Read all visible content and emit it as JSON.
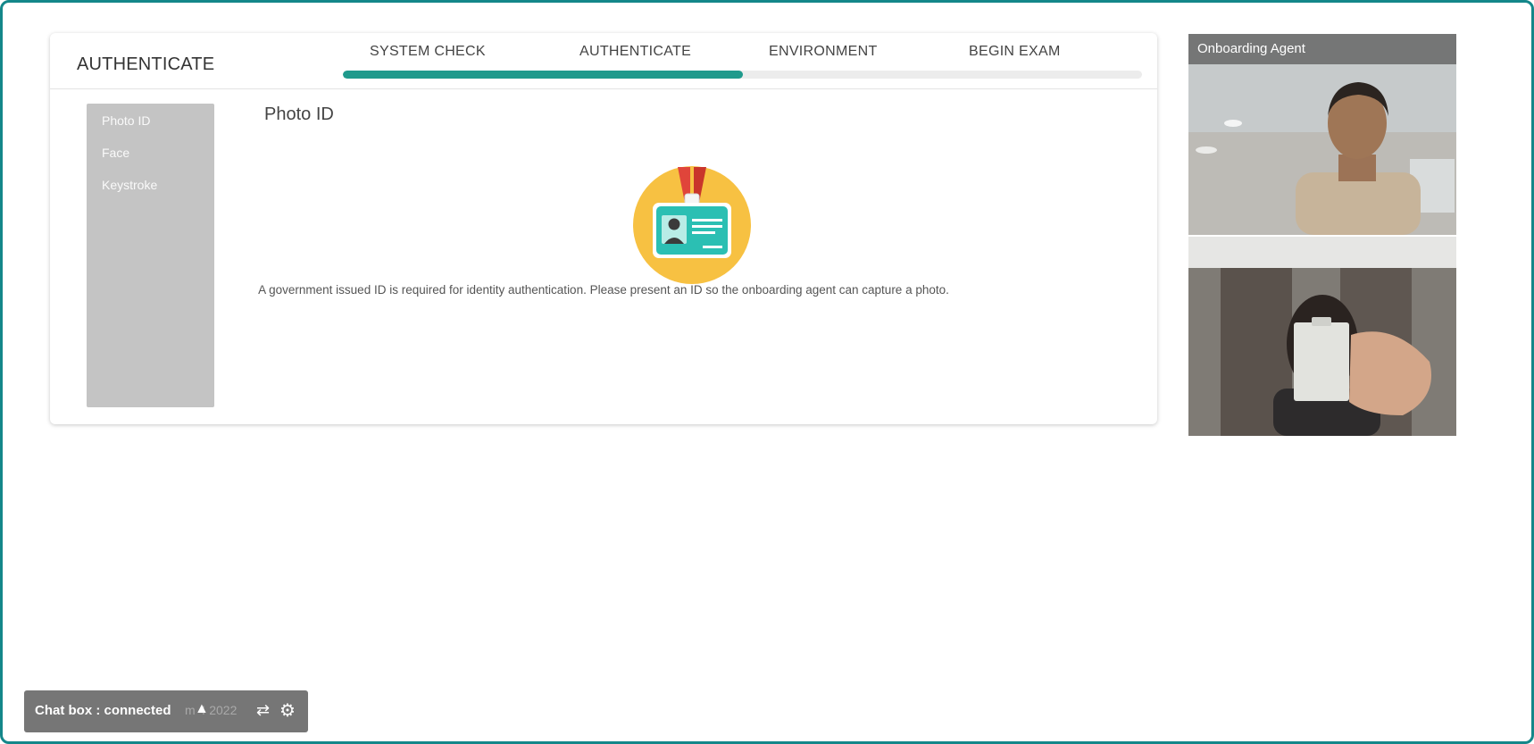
{
  "header": {
    "section_title": "AUTHENTICATE"
  },
  "steps": [
    {
      "label": "SYSTEM CHECK"
    },
    {
      "label": "AUTHENTICATE"
    },
    {
      "label": "ENVIRONMENT"
    },
    {
      "label": "BEGIN EXAM"
    }
  ],
  "progress": {
    "completed_fraction": 0.5,
    "color": "#1f9a8c"
  },
  "sidebar": {
    "items": [
      {
        "label": "Photo ID"
      },
      {
        "label": "Face"
      },
      {
        "label": "Keystroke"
      }
    ]
  },
  "main": {
    "title": "Photo ID",
    "description": "A government issued ID is required for identity authentication. Please present an ID so the onboarding agent can capture a photo.",
    "icon": "id-badge-icon"
  },
  "video": {
    "agent_label": "Onboarding Agent"
  },
  "chat": {
    "label": "Chat box : connected",
    "partial_text": "m 4 2022",
    "icons": [
      "chevron-up-icon",
      "swap-icon",
      "gear-icon"
    ]
  },
  "colors": {
    "accent": "#1f9a8c",
    "frame": "#14878a",
    "sidebar": "#c4c4c4",
    "chat_bg": "#767676"
  }
}
